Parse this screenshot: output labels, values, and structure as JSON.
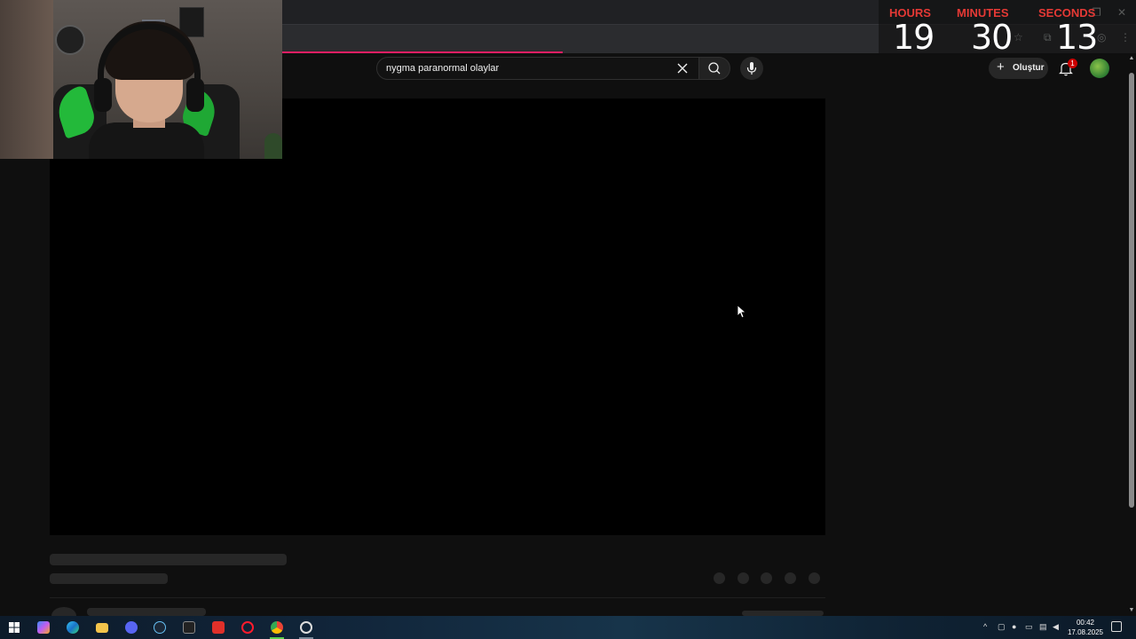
{
  "search": {
    "query": "nygma paranormal olaylar"
  },
  "header": {
    "create_label": "Oluştur",
    "notification_count": "1"
  },
  "timer": {
    "hours_label": "HOURS",
    "minutes_label": "MINUTES",
    "seconds_label": "SECONDS",
    "hours": "19",
    "minutes": "30",
    "seconds": "13"
  },
  "taskbar": {
    "time": "00:42",
    "date": "17.08.2025",
    "apps": [
      "start-icon",
      "copilot-icon",
      "edge-icon",
      "file-explorer-icon",
      "discord-icon",
      "steam-icon",
      "epic-games-icon",
      "app-red-icon",
      "opera-icon",
      "chrome-icon",
      "clock-app-icon"
    ]
  },
  "colors": {
    "accent_red": "#e53935",
    "load_bar": "#e91e63",
    "taskbar_active": "#5bd04f",
    "badge": "#cc0000"
  }
}
